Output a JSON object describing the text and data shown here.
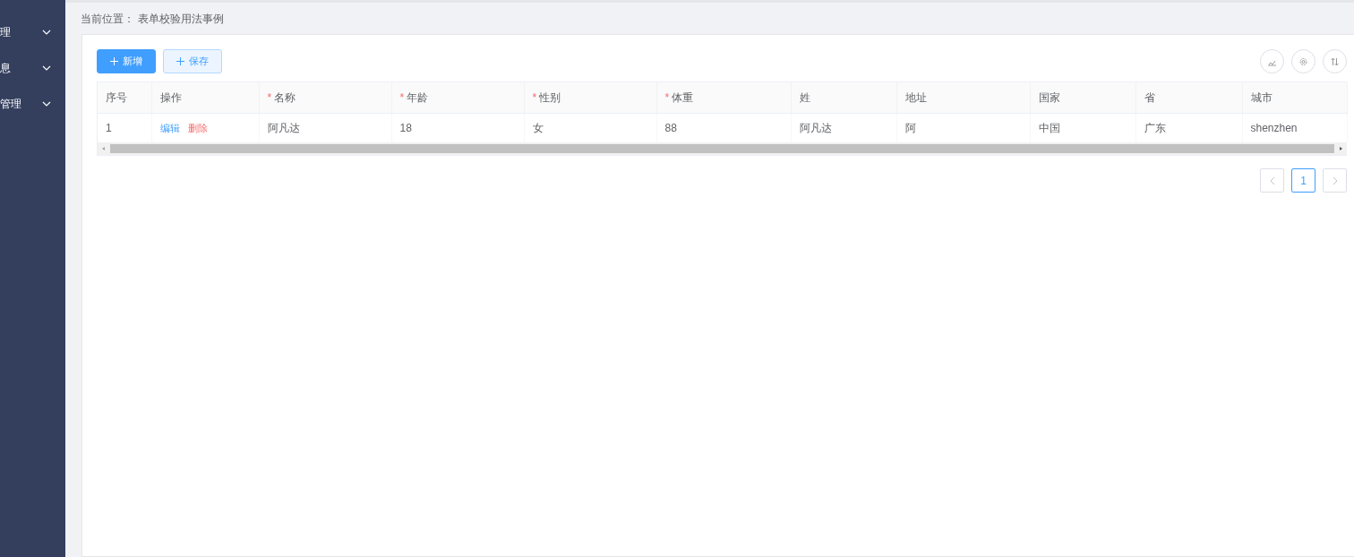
{
  "sidebar": {
    "items": [
      {
        "label": "理",
        "expanded": false
      },
      {
        "label": "息",
        "expanded": false
      },
      {
        "label": "管理",
        "expanded": false
      }
    ]
  },
  "breadcrumb": {
    "label": "当前位置：",
    "current": "表单校验用法事例"
  },
  "toolbar": {
    "buttons": [
      {
        "label": "新增",
        "kind": "primary"
      },
      {
        "label": "保存",
        "kind": "plain"
      }
    ],
    "tools": [
      {
        "kind": "export"
      },
      {
        "kind": "settings"
      },
      {
        "kind": "sort"
      }
    ]
  },
  "table": {
    "columns": [
      {
        "label": "序号",
        "required": false
      },
      {
        "label": "操作",
        "required": false
      },
      {
        "label": "名称",
        "required": true,
        "marker": "*"
      },
      {
        "label": "年龄",
        "required": true,
        "marker": "*"
      },
      {
        "label": "性别",
        "required": true,
        "marker": "*"
      },
      {
        "label": "体重",
        "required": true,
        "marker": "*"
      },
      {
        "label": "姓",
        "required": false
      },
      {
        "label": "地址",
        "required": false
      },
      {
        "label": "国家",
        "required": false
      },
      {
        "label": "省",
        "required": false
      },
      {
        "label": "城市",
        "required": false
      }
    ],
    "rows": [
      {
        "cells": [
          "1",
          null,
          "阿凡达",
          "18",
          "女",
          "88",
          "阿凡达",
          "阿",
          "中国",
          "广东",
          "shenzhen"
        ],
        "actions": [
          {
            "label": "编辑",
            "kind": "edit"
          },
          {
            "label": "删除",
            "kind": "delete"
          }
        ]
      }
    ]
  },
  "pagination": {
    "pages": [
      {
        "label": "1",
        "selected": true
      }
    ]
  }
}
